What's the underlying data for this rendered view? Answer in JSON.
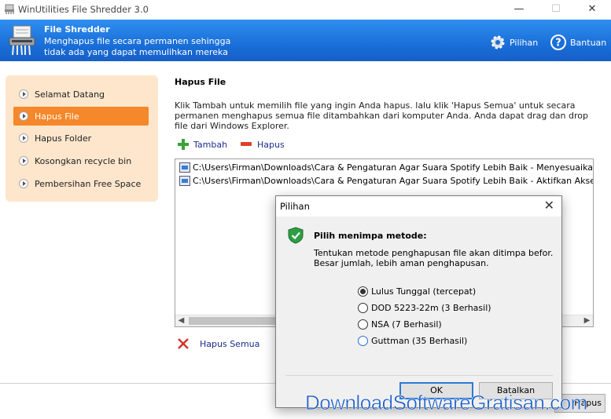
{
  "window": {
    "title": "WinUtilities File Shredder 3.0",
    "minimize": "—",
    "maximize": "☐",
    "close": "✕"
  },
  "header": {
    "title": "File Shredder",
    "description": "Menghapus file secara permanen sehingga tidak ada yang dapat memulihkan mereka",
    "options_label": "Pilihan",
    "help_label": "Bantuan"
  },
  "sidebar": {
    "items": [
      {
        "label": "Selamat Datang",
        "active": false
      },
      {
        "label": "Hapus File",
        "active": true
      },
      {
        "label": "Hapus Folder",
        "active": false
      },
      {
        "label": "Kosongkan recycle bin",
        "active": false
      },
      {
        "label": "Pembersihan Free Space",
        "active": false
      }
    ]
  },
  "main": {
    "title": "Hapus File",
    "description": "Klik Tambah untuk memilih file yang ingin Anda hapus. lalu klik 'Hapus Semua' untuk secara permanen menghapus semua file ditambahkan  dari komputer Anda. Anda dapat drag dan drop file  dari Windows Explorer.",
    "add_label": "Tambah",
    "remove_label": "Hapus",
    "files": [
      "C:\\Users\\Firman\\Downloads\\Cara & Pengaturan Agar Suara Spotify Lebih Baik - Menyesuaikan Peng",
      "C:\\Users\\Firman\\Downloads\\Cara & Pengaturan Agar Suara Spotify Lebih Baik - Aktifkan Akselerasi"
    ],
    "delete_all_label": "Hapus Semua",
    "hidden_button_label": "Hapus"
  },
  "dialog": {
    "title": "Pilihan",
    "heading": "Pilih menimpa metode:",
    "text": "Tentukan metode penghapusan file akan ditimpa befor. Besar jumlah, lebih aman penghapusan.",
    "options": [
      {
        "label": "Lulus Tunggal (tercepat)",
        "selected": true
      },
      {
        "label": "DOD 5223-22m (3 Berhasil)",
        "selected": false
      },
      {
        "label": "NSA (7 Berhasil)",
        "selected": false
      },
      {
        "label": "Guttman (35 Berhasil)",
        "selected": false
      }
    ],
    "ok_label": "OK",
    "cancel_label": "Batalkan"
  },
  "watermark": "DownloadSoftwareGratisan.com",
  "colors": {
    "header_blue": "#1a6fd8",
    "sidebar_bg": "#fde6cc",
    "active_orange": "#f5882a",
    "link_blue": "#1a2d8c"
  }
}
